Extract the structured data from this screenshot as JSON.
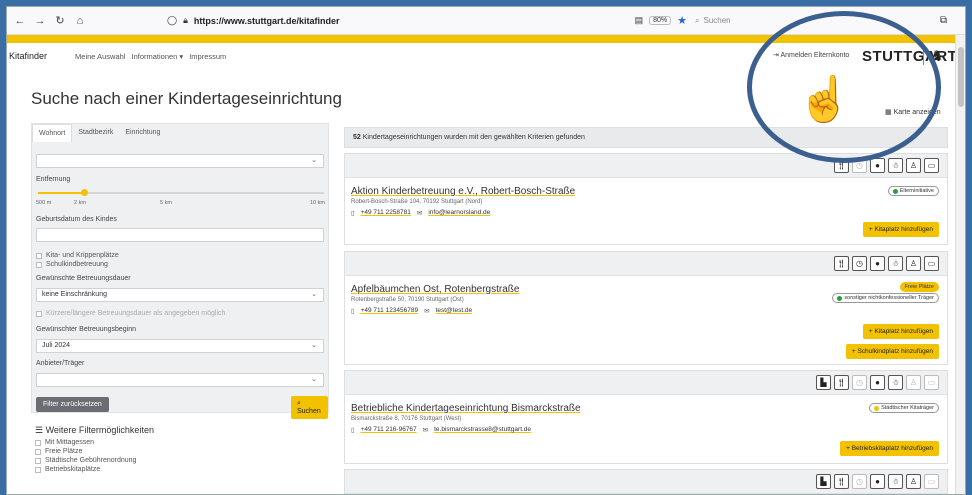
{
  "browser": {
    "url": "https://www.stuttgart.de/kitafinder",
    "zoom": "80%",
    "search_placeholder": "Suchen"
  },
  "site": {
    "brand": "Kitafinder",
    "nav": [
      "Meine Auswahl",
      "Informationen ▾",
      "Impressum"
    ],
    "login": "Anmelden Elternkonto",
    "logo": "STUTTGART",
    "page_title": "Suche nach einer Kindertageseinrichtung",
    "map_link": "Karte anzeigen"
  },
  "filter": {
    "tabs": [
      "Wohnort",
      "Stadtbezirk",
      "Einrichtung"
    ],
    "distance_label": "Entfernung",
    "distance_ticks": [
      "500 m",
      "2 km",
      "5 km",
      "10 km"
    ],
    "distance_value": 0.16,
    "birthdate_label": "Geburtsdatum des Kindes",
    "checks_top": [
      "Kita- und Krippenplätze",
      "Schulkindbetreuung"
    ],
    "duration_label": "Gewünschte Betreuungsdauer",
    "duration_value": "keine Einschränkung",
    "duration_check": "Kürzere/längere Betreuungsdauer als angegeben möglich",
    "start_label": "Gewünschter Betreuungsbeginn",
    "start_value": "Juli 2024",
    "provider_label": "Anbieter/Träger",
    "reset_label": "Filter zurücksetzen",
    "search_label": "Suchen",
    "more_title": "Weitere Filtermöglichkeiten",
    "more_checks": [
      "Mit Mittagessen",
      "Freie Plätze",
      "Städtische Gebührenordnung",
      "Betriebskitaplätze"
    ]
  },
  "results": {
    "count": "52",
    "summary": "Kindertageseinrichtungen wurden mit den gewählten Kriterien gefunden",
    "cards": [
      {
        "title": "Aktion Kinderbetreuung e.V., Robert-Bosch-Straße",
        "address": "Robert-Bosch-Straße 104, 70192 Stuttgart (Nord)",
        "phone": "+49 711 2258781",
        "email": "info@learnorsland.de",
        "badge": "Elterninitiative",
        "button": "+ Kitaplatz hinzufügen"
      },
      {
        "title": "Apfelbäumchen Ost, Rotenbergstraße",
        "address": "Rotenbergstraße 50, 70190 Stuttgart (Ost)",
        "phone": "+49 711 123456789",
        "email": "test@test.de",
        "badge_free": "Freie Plätze",
        "badge": "sonstiger nichtkonfessioneller Träger",
        "button": "+ Kitaplatz hinzufügen",
        "button2": "+ Schulkindplatz hinzufügen"
      },
      {
        "title": "Betriebliche Kindertageseinrichtung Bismarckstraße",
        "address": "Bismarckstraße 8, 70176 Stuttgart (West)",
        "phone": "+49 711 216-96767",
        "email": "te.bismarckstrasse8@stuttgart.de",
        "badge": "Städtischer Kitaträger",
        "button": "+ Betriebskitaplatz hinzufügen"
      }
    ]
  },
  "colors": {
    "accent": "#f2c100",
    "overlay_circle": "#3b5f8f"
  }
}
